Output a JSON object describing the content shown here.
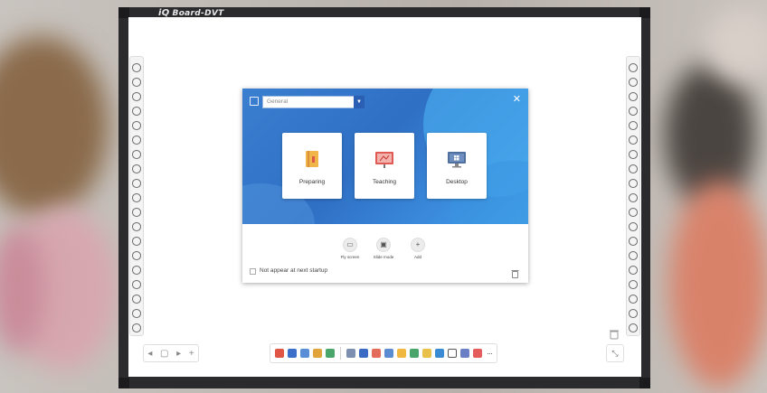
{
  "board": {
    "brand": "iQ",
    "model": "Board-DVT"
  },
  "dialog": {
    "select_value": "General",
    "modes": [
      {
        "label": "Preparing",
        "icon": "book-icon"
      },
      {
        "label": "Teaching",
        "icon": "chalkboard-icon"
      },
      {
        "label": "Desktop",
        "icon": "monitor-icon"
      }
    ],
    "tools": [
      {
        "label": "Fly screen",
        "icon": "fly-screen-icon"
      },
      {
        "label": "Slide mode",
        "icon": "slide-mode-icon"
      },
      {
        "label": "Add",
        "icon": "plus-icon"
      }
    ],
    "startup_label": "Not appear at next startup"
  },
  "toolbar": {
    "more_label": "···"
  },
  "colors": {
    "header_blue": "#2f6fc4",
    "board_frame": "#2b2b2e"
  }
}
